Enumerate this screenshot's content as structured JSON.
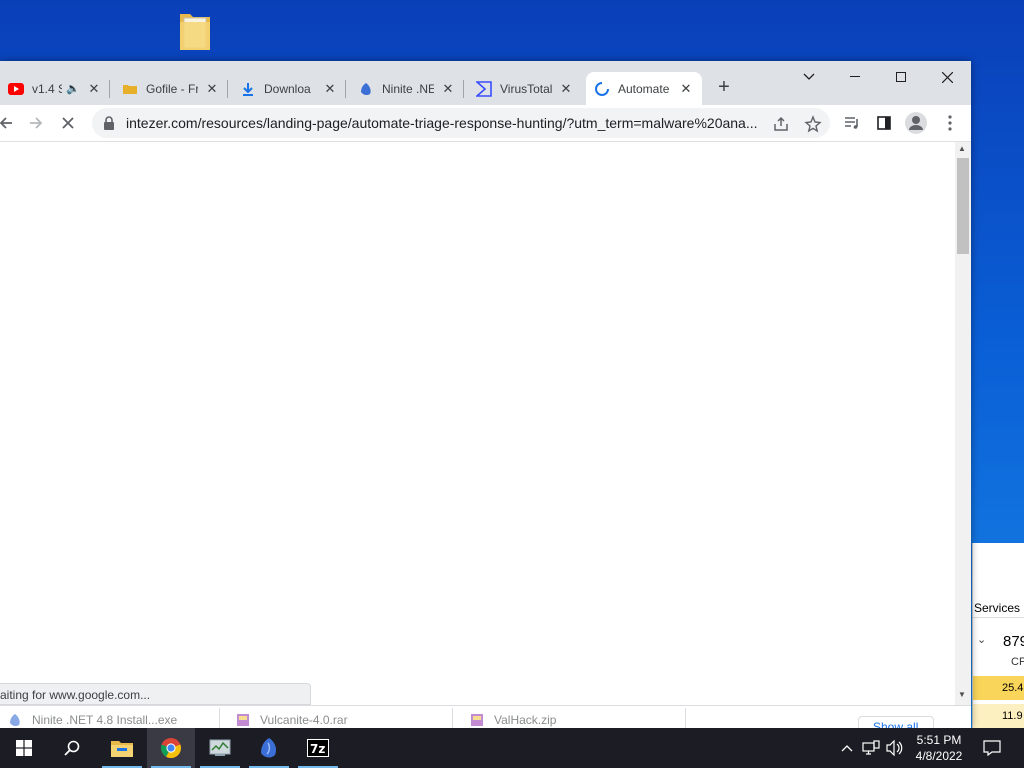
{
  "colors": {
    "desktop_top": "#0a3fb8",
    "desktop_bottom": "#1a8ae8",
    "tabstrip_bg": "#dee1e6",
    "taskbar_bg": "#1c1c24",
    "task_manager_highlight": "#f9d55a",
    "taskbar_active_underline": "#76b9ed"
  },
  "tabs": [
    {
      "title": "v1.4 S",
      "icon": "youtube-icon",
      "audio": true
    },
    {
      "title": "Gofile - Fr",
      "icon": "gofile-icon"
    },
    {
      "title": "Downloa",
      "icon": "download-icon"
    },
    {
      "title": "Ninite .NE",
      "icon": "ninite-icon"
    },
    {
      "title": "VirusTotal",
      "icon": "virustotal-icon"
    },
    {
      "title": "Automate",
      "icon": "loading-spinner-icon",
      "active": true
    }
  ],
  "toolbar": {
    "url": "intezer.com/resources/landing-page/automate-triage-response-hunting/?utm_term=malware%20ana..."
  },
  "status": {
    "text": "aiting for www.google.com..."
  },
  "downloads": [
    {
      "name": "Ninite .NET 4.8 Install...exe"
    },
    {
      "name": "Vulcanite-4.0.rar"
    },
    {
      "name": "ValHack.zip"
    }
  ],
  "downloads_show_all": "Show all",
  "task_manager": {
    "tab": "Services",
    "cpu_value": "879",
    "cpu_label": "CP",
    "row1": "25.4",
    "row2": "11.9"
  },
  "taskbar": {
    "apps": [
      "start-icon",
      "search-icon",
      "file-explorer-icon",
      "chrome-icon",
      "task-manager-icon",
      "ninite-icon",
      "7zip-icon"
    ]
  },
  "clock": {
    "time": "5:51 PM",
    "date": "4/8/2022"
  }
}
